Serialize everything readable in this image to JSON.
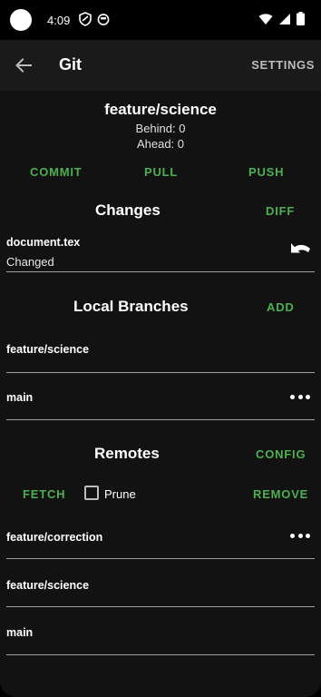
{
  "status_bar": {
    "time": "4:09",
    "icons": [
      "shield-icon",
      "cat-face-icon",
      "wifi-icon",
      "cellular-signal-icon",
      "battery-icon"
    ]
  },
  "app_bar": {
    "title": "Git",
    "back_icon": "arrow-back-icon",
    "settings_label": "SETTINGS"
  },
  "branch": {
    "name": "feature/science",
    "behind": "Behind: 0",
    "ahead": "Ahead: 0"
  },
  "actions": {
    "commit": "COMMIT",
    "pull": "PULL",
    "push": "PUSH"
  },
  "changes": {
    "title": "Changes",
    "diff_label": "DIFF",
    "items": [
      {
        "file": "document.tex",
        "status": "Changed",
        "action_icon": "undo-icon"
      }
    ]
  },
  "local_branches": {
    "title": "Local Branches",
    "add_label": "ADD",
    "items": [
      {
        "name": "feature/science"
      },
      {
        "name": "main",
        "menu_icon": "more-horizontal-icon"
      }
    ]
  },
  "remotes": {
    "title": "Remotes",
    "config_label": "CONFIG",
    "fetch_label": "FETCH",
    "prune_label": "Prune",
    "prune_checked": false,
    "remove_label": "REMOVE",
    "items": [
      {
        "name": "feature/correction",
        "menu_icon": "more-horizontal-icon"
      },
      {
        "name": "feature/science"
      },
      {
        "name": "main"
      }
    ]
  },
  "colors": {
    "accent": "#4caf50",
    "background": "#121212",
    "app_bar": "#1a1a1a"
  }
}
